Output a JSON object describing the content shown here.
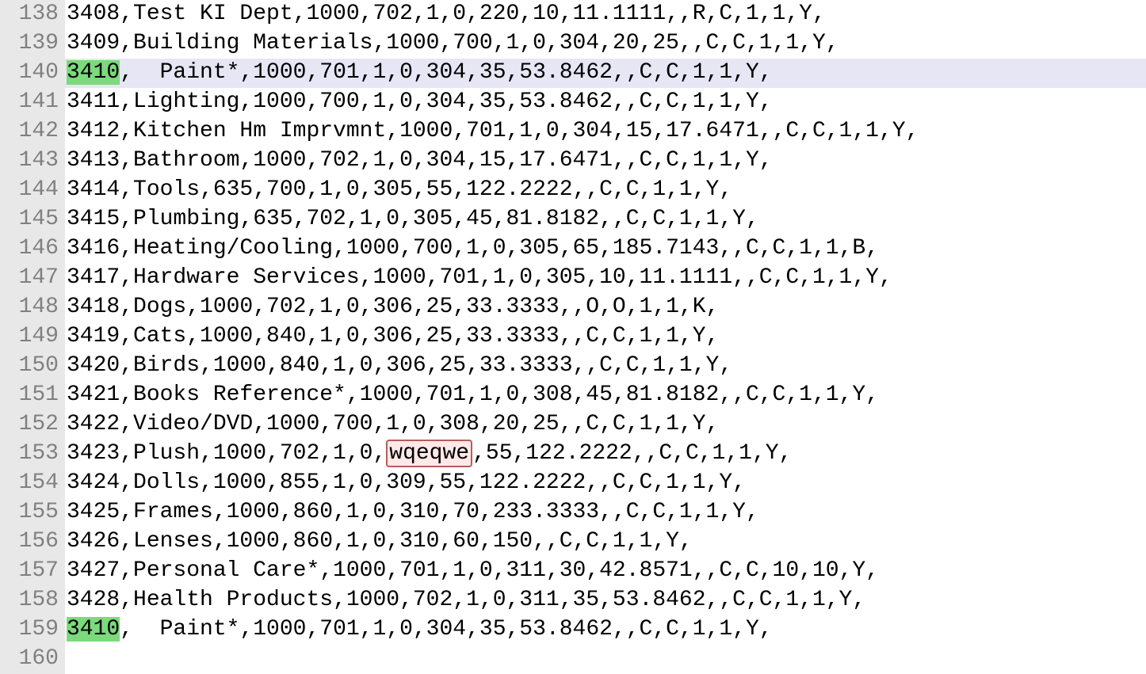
{
  "lines": [
    {
      "num": 138,
      "text": "3408,Test KI Dept,1000,702,1,0,220,10,11.1111,,R,C,1,1,Y,",
      "highlighted": false,
      "searchMatch": null,
      "errorMatch": null
    },
    {
      "num": 139,
      "text": "3409,Building Materials,1000,700,1,0,304,20,25,,C,C,1,1,Y,",
      "highlighted": false,
      "searchMatch": null,
      "errorMatch": null
    },
    {
      "num": 140,
      "text": "3410,  Paint*,1000,701,1,0,304,35,53.8462,,C,C,1,1,Y,",
      "highlighted": true,
      "searchMatch": "3410",
      "errorMatch": null
    },
    {
      "num": 141,
      "text": "3411,Lighting,1000,700,1,0,304,35,53.8462,,C,C,1,1,Y,",
      "highlighted": false,
      "searchMatch": null,
      "errorMatch": null
    },
    {
      "num": 142,
      "text": "3412,Kitchen Hm Imprvmnt,1000,701,1,0,304,15,17.6471,,C,C,1,1,Y,",
      "highlighted": false,
      "searchMatch": null,
      "errorMatch": null
    },
    {
      "num": 143,
      "text": "3413,Bathroom,1000,702,1,0,304,15,17.6471,,C,C,1,1,Y,",
      "highlighted": false,
      "searchMatch": null,
      "errorMatch": null
    },
    {
      "num": 144,
      "text": "3414,Tools,635,700,1,0,305,55,122.2222,,C,C,1,1,Y,",
      "highlighted": false,
      "searchMatch": null,
      "errorMatch": null
    },
    {
      "num": 145,
      "text": "3415,Plumbing,635,702,1,0,305,45,81.8182,,C,C,1,1,Y,",
      "highlighted": false,
      "searchMatch": null,
      "errorMatch": null
    },
    {
      "num": 146,
      "text": "3416,Heating/Cooling,1000,700,1,0,305,65,185.7143,,C,C,1,1,B,",
      "highlighted": false,
      "searchMatch": null,
      "errorMatch": null
    },
    {
      "num": 147,
      "text": "3417,Hardware Services,1000,701,1,0,305,10,11.1111,,C,C,1,1,Y,",
      "highlighted": false,
      "searchMatch": null,
      "errorMatch": null
    },
    {
      "num": 148,
      "text": "3418,Dogs,1000,702,1,0,306,25,33.3333,,O,O,1,1,K,",
      "highlighted": false,
      "searchMatch": null,
      "errorMatch": null
    },
    {
      "num": 149,
      "text": "3419,Cats,1000,840,1,0,306,25,33.3333,,C,C,1,1,Y,",
      "highlighted": false,
      "searchMatch": null,
      "errorMatch": null
    },
    {
      "num": 150,
      "text": "3420,Birds,1000,840,1,0,306,25,33.3333,,C,C,1,1,Y,",
      "highlighted": false,
      "searchMatch": null,
      "errorMatch": null
    },
    {
      "num": 151,
      "text": "3421,Books Reference*,1000,701,1,0,308,45,81.8182,,C,C,1,1,Y,",
      "highlighted": false,
      "searchMatch": null,
      "errorMatch": null
    },
    {
      "num": 152,
      "text": "3422,Video/DVD,1000,700,1,0,308,20,25,,C,C,1,1,Y,",
      "highlighted": false,
      "searchMatch": null,
      "errorMatch": null
    },
    {
      "num": 153,
      "text": "3423,Plush,1000,702,1,0,wqeqwe,55,122.2222,,C,C,1,1,Y,",
      "highlighted": false,
      "searchMatch": null,
      "errorMatch": "wqeqwe"
    },
    {
      "num": 154,
      "text": "3424,Dolls,1000,855,1,0,309,55,122.2222,,C,C,1,1,Y,",
      "highlighted": false,
      "searchMatch": null,
      "errorMatch": null
    },
    {
      "num": 155,
      "text": "3425,Frames,1000,860,1,0,310,70,233.3333,,C,C,1,1,Y,",
      "highlighted": false,
      "searchMatch": null,
      "errorMatch": null
    },
    {
      "num": 156,
      "text": "3426,Lenses,1000,860,1,0,310,60,150,,C,C,1,1,Y,",
      "highlighted": false,
      "searchMatch": null,
      "errorMatch": null
    },
    {
      "num": 157,
      "text": "3427,Personal Care*,1000,701,1,0,311,30,42.8571,,C,C,10,10,Y,",
      "highlighted": false,
      "searchMatch": null,
      "errorMatch": null
    },
    {
      "num": 158,
      "text": "3428,Health Products,1000,702,1,0,311,35,53.8462,,C,C,1,1,Y,",
      "highlighted": false,
      "searchMatch": null,
      "errorMatch": null
    },
    {
      "num": 159,
      "text": "3410,  Paint*,1000,701,1,0,304,35,53.8462,,C,C,1,1,Y,",
      "highlighted": false,
      "searchMatch": "3410",
      "errorMatch": null
    },
    {
      "num": 160,
      "text": "",
      "highlighted": false,
      "searchMatch": null,
      "errorMatch": null
    }
  ]
}
